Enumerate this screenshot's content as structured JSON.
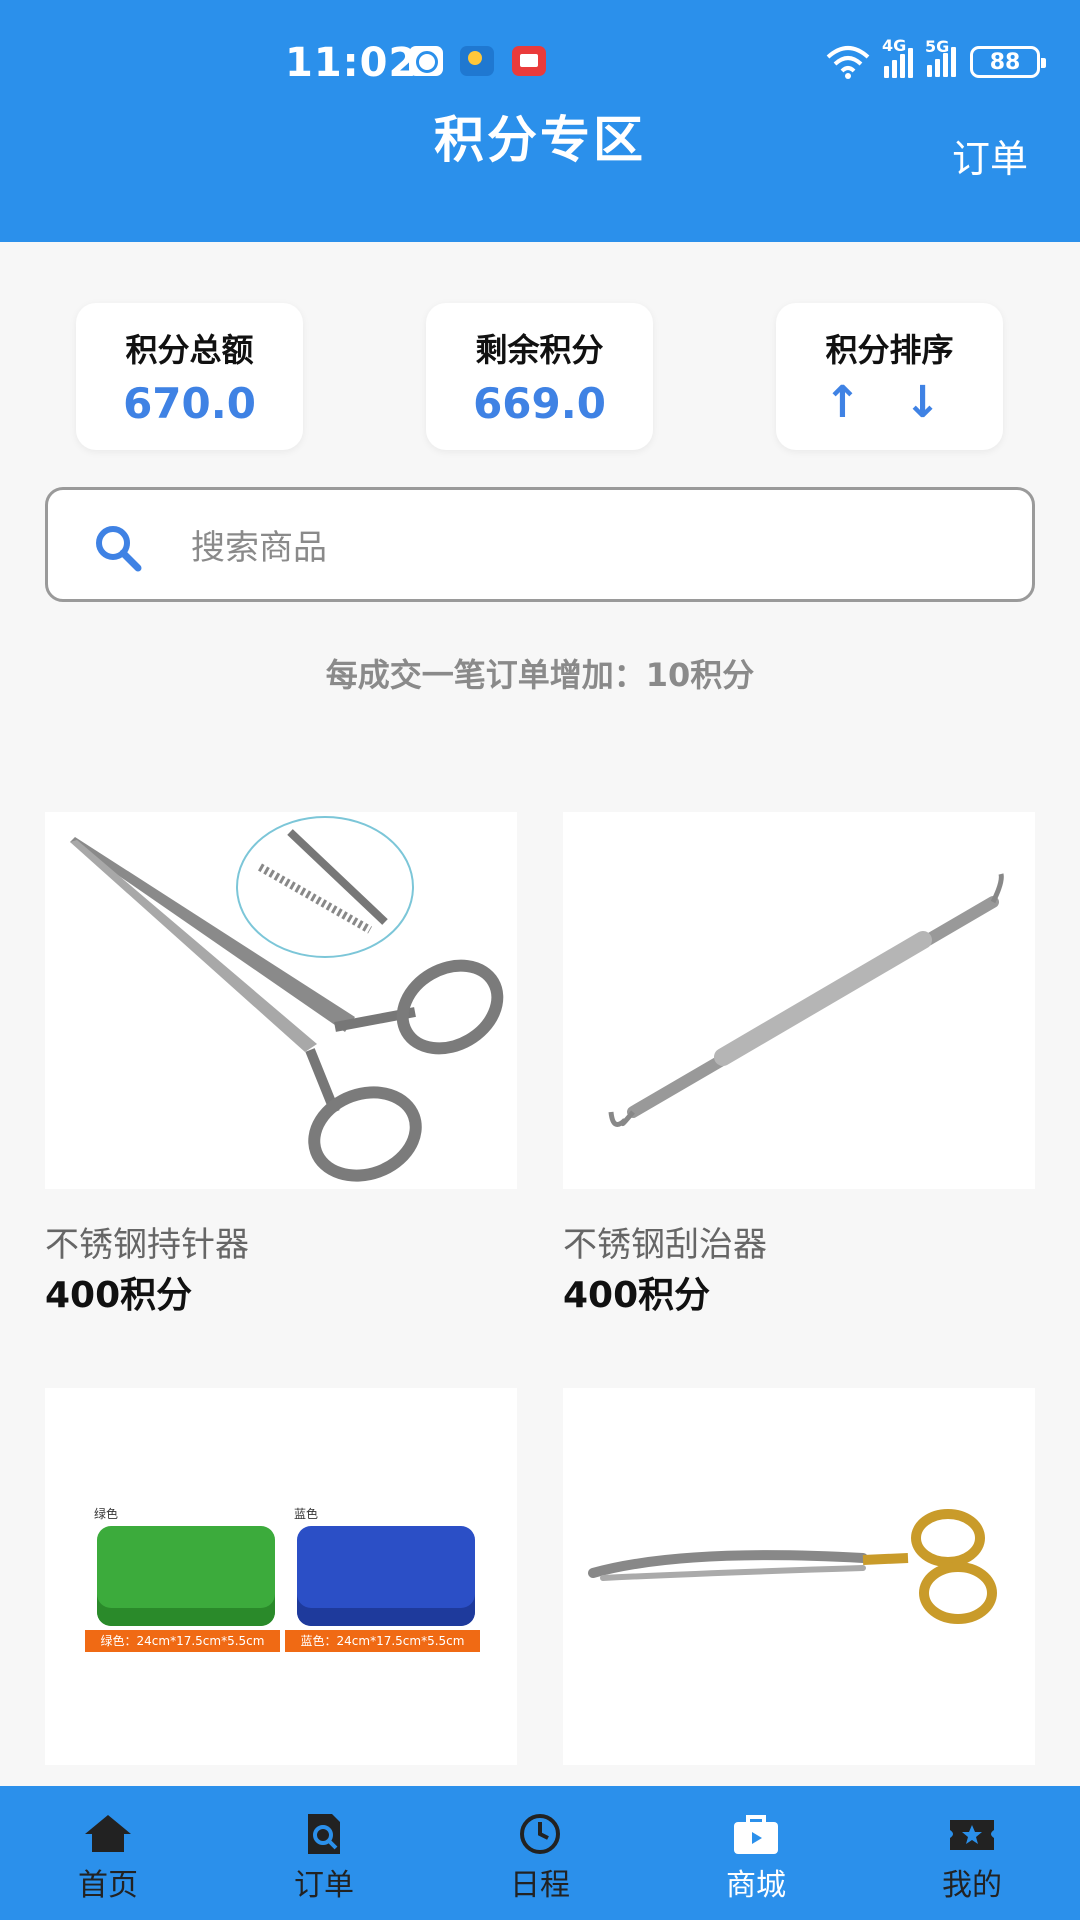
{
  "status_bar": {
    "time": "11:02",
    "net1": "4G",
    "net2": "5G",
    "battery": "88"
  },
  "header": {
    "title": "积分专区",
    "right_link": "订单"
  },
  "stats": [
    {
      "label": "积分总额",
      "value": "670.0"
    },
    {
      "label": "剩余积分",
      "value": "669.0"
    },
    {
      "label": "积分排序",
      "value": "↑ ↓"
    }
  ],
  "search": {
    "placeholder": "搜索商品"
  },
  "hint": "每成交一笔订单增加：10积分",
  "products": [
    {
      "name": "不锈钢持针器",
      "price": "400积分",
      "image": "needle-holder"
    },
    {
      "name": "不锈钢刮治器",
      "price": "400积分",
      "image": "scaler"
    },
    {
      "name": "",
      "price": "",
      "image": "sterilization-box",
      "labels": [
        "绿色",
        "蓝色"
      ],
      "sizes": [
        "绿色：24cm*17.5cm*5.5cm",
        "蓝色：24cm*17.5cm*5.5cm"
      ]
    },
    {
      "name": "",
      "price": "",
      "image": "curved-scissors"
    }
  ],
  "nav": [
    {
      "label": "首页",
      "icon": "home-icon",
      "active": false
    },
    {
      "label": "订单",
      "icon": "order-icon",
      "active": false
    },
    {
      "label": "日程",
      "icon": "clock-icon",
      "active": false
    },
    {
      "label": "商城",
      "icon": "shop-icon",
      "active": true
    },
    {
      "label": "我的",
      "icon": "ticket-icon",
      "active": false
    }
  ],
  "colors": {
    "primary": "#2b90eb",
    "accent": "#3f82e4"
  }
}
